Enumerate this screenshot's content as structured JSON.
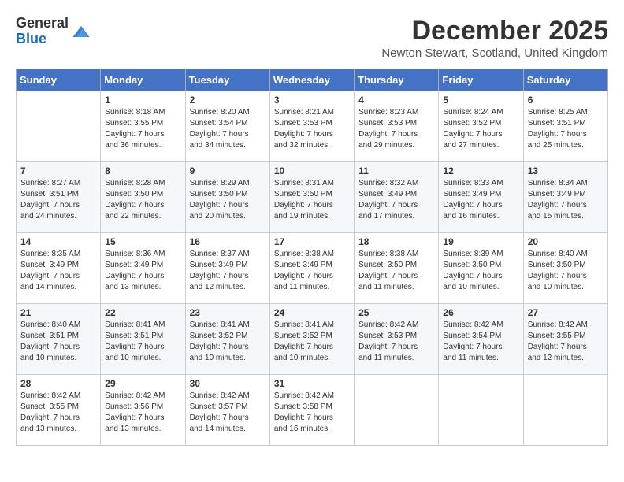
{
  "header": {
    "logo_line1": "General",
    "logo_line2": "Blue",
    "month_year": "December 2025",
    "location": "Newton Stewart, Scotland, United Kingdom"
  },
  "days_of_week": [
    "Sunday",
    "Monday",
    "Tuesday",
    "Wednesday",
    "Thursday",
    "Friday",
    "Saturday"
  ],
  "weeks": [
    [
      {
        "num": "",
        "info": ""
      },
      {
        "num": "1",
        "info": "Sunrise: 8:18 AM\nSunset: 3:55 PM\nDaylight: 7 hours\nand 36 minutes."
      },
      {
        "num": "2",
        "info": "Sunrise: 8:20 AM\nSunset: 3:54 PM\nDaylight: 7 hours\nand 34 minutes."
      },
      {
        "num": "3",
        "info": "Sunrise: 8:21 AM\nSunset: 3:53 PM\nDaylight: 7 hours\nand 32 minutes."
      },
      {
        "num": "4",
        "info": "Sunrise: 8:23 AM\nSunset: 3:53 PM\nDaylight: 7 hours\nand 29 minutes."
      },
      {
        "num": "5",
        "info": "Sunrise: 8:24 AM\nSunset: 3:52 PM\nDaylight: 7 hours\nand 27 minutes."
      },
      {
        "num": "6",
        "info": "Sunrise: 8:25 AM\nSunset: 3:51 PM\nDaylight: 7 hours\nand 25 minutes."
      }
    ],
    [
      {
        "num": "7",
        "info": "Sunrise: 8:27 AM\nSunset: 3:51 PM\nDaylight: 7 hours\nand 24 minutes."
      },
      {
        "num": "8",
        "info": "Sunrise: 8:28 AM\nSunset: 3:50 PM\nDaylight: 7 hours\nand 22 minutes."
      },
      {
        "num": "9",
        "info": "Sunrise: 8:29 AM\nSunset: 3:50 PM\nDaylight: 7 hours\nand 20 minutes."
      },
      {
        "num": "10",
        "info": "Sunrise: 8:31 AM\nSunset: 3:50 PM\nDaylight: 7 hours\nand 19 minutes."
      },
      {
        "num": "11",
        "info": "Sunrise: 8:32 AM\nSunset: 3:49 PM\nDaylight: 7 hours\nand 17 minutes."
      },
      {
        "num": "12",
        "info": "Sunrise: 8:33 AM\nSunset: 3:49 PM\nDaylight: 7 hours\nand 16 minutes."
      },
      {
        "num": "13",
        "info": "Sunrise: 8:34 AM\nSunset: 3:49 PM\nDaylight: 7 hours\nand 15 minutes."
      }
    ],
    [
      {
        "num": "14",
        "info": "Sunrise: 8:35 AM\nSunset: 3:49 PM\nDaylight: 7 hours\nand 14 minutes."
      },
      {
        "num": "15",
        "info": "Sunrise: 8:36 AM\nSunset: 3:49 PM\nDaylight: 7 hours\nand 13 minutes."
      },
      {
        "num": "16",
        "info": "Sunrise: 8:37 AM\nSunset: 3:49 PM\nDaylight: 7 hours\nand 12 minutes."
      },
      {
        "num": "17",
        "info": "Sunrise: 8:38 AM\nSunset: 3:49 PM\nDaylight: 7 hours\nand 11 minutes."
      },
      {
        "num": "18",
        "info": "Sunrise: 8:38 AM\nSunset: 3:50 PM\nDaylight: 7 hours\nand 11 minutes."
      },
      {
        "num": "19",
        "info": "Sunrise: 8:39 AM\nSunset: 3:50 PM\nDaylight: 7 hours\nand 10 minutes."
      },
      {
        "num": "20",
        "info": "Sunrise: 8:40 AM\nSunset: 3:50 PM\nDaylight: 7 hours\nand 10 minutes."
      }
    ],
    [
      {
        "num": "21",
        "info": "Sunrise: 8:40 AM\nSunset: 3:51 PM\nDaylight: 7 hours\nand 10 minutes."
      },
      {
        "num": "22",
        "info": "Sunrise: 8:41 AM\nSunset: 3:51 PM\nDaylight: 7 hours\nand 10 minutes."
      },
      {
        "num": "23",
        "info": "Sunrise: 8:41 AM\nSunset: 3:52 PM\nDaylight: 7 hours\nand 10 minutes."
      },
      {
        "num": "24",
        "info": "Sunrise: 8:41 AM\nSunset: 3:52 PM\nDaylight: 7 hours\nand 10 minutes."
      },
      {
        "num": "25",
        "info": "Sunrise: 8:42 AM\nSunset: 3:53 PM\nDaylight: 7 hours\nand 11 minutes."
      },
      {
        "num": "26",
        "info": "Sunrise: 8:42 AM\nSunset: 3:54 PM\nDaylight: 7 hours\nand 11 minutes."
      },
      {
        "num": "27",
        "info": "Sunrise: 8:42 AM\nSunset: 3:55 PM\nDaylight: 7 hours\nand 12 minutes."
      }
    ],
    [
      {
        "num": "28",
        "info": "Sunrise: 8:42 AM\nSunset: 3:55 PM\nDaylight: 7 hours\nand 13 minutes."
      },
      {
        "num": "29",
        "info": "Sunrise: 8:42 AM\nSunset: 3:56 PM\nDaylight: 7 hours\nand 13 minutes."
      },
      {
        "num": "30",
        "info": "Sunrise: 8:42 AM\nSunset: 3:57 PM\nDaylight: 7 hours\nand 14 minutes."
      },
      {
        "num": "31",
        "info": "Sunrise: 8:42 AM\nSunset: 3:58 PM\nDaylight: 7 hours\nand 16 minutes."
      },
      {
        "num": "",
        "info": ""
      },
      {
        "num": "",
        "info": ""
      },
      {
        "num": "",
        "info": ""
      }
    ]
  ]
}
